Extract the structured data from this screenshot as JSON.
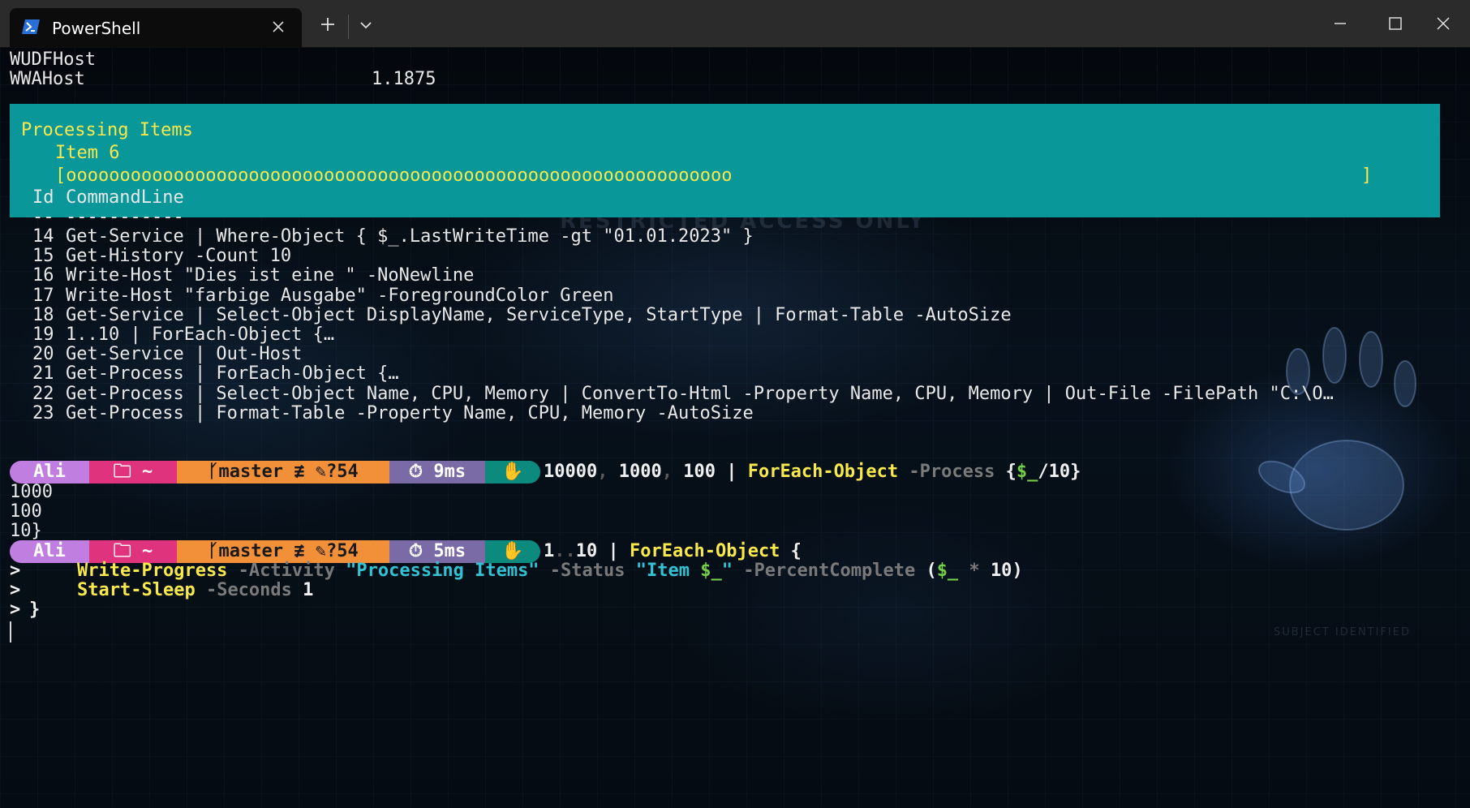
{
  "window": {
    "tab_title": "PowerShell",
    "tab_icon": "powershell-icon",
    "new_tab_icon": "plus-icon",
    "dropdown_icon": "chevron-down-icon",
    "minimize_icon": "minimize-icon",
    "maximize_icon": "maximize-icon",
    "close_icon": "close-icon"
  },
  "background": {
    "watermark": "RESTRICTED ACCESS ONLY",
    "watermark2": "SUBJECT IDENTIFIED"
  },
  "output_top": [
    {
      "name": "WUDFHost",
      "value": ""
    },
    {
      "name": "WWAHost",
      "value": "1.1875"
    }
  ],
  "progress": {
    "activity": "Processing Items",
    "status": "Item 6",
    "bar_open": "[",
    "bar_fill": "oooooooooooooooooooooooooooooooooooooooooooooooooooooooooooooo",
    "bar_close": "]",
    "percent_complete": 0.6,
    "background_color": "#0a979a",
    "text_color": "#f7e84c"
  },
  "history": {
    "header_id": "Id",
    "header_cmd": "CommandLine",
    "rule_id": "--",
    "rule_cmd": "-----------",
    "rows": [
      {
        "id": "14",
        "cmd": "Get-Service | Where-Object { $_.LastWriteTime -gt \"01.01.2023\" }"
      },
      {
        "id": "15",
        "cmd": "Get-History -Count 10"
      },
      {
        "id": "16",
        "cmd": "Write-Host \"Dies ist eine \" -NoNewline"
      },
      {
        "id": "17",
        "cmd": "Write-Host \"farbige Ausgabe\" -ForegroundColor Green"
      },
      {
        "id": "18",
        "cmd": "Get-Service | Select-Object DisplayName, ServiceType, StartType | Format-Table -AutoSize"
      },
      {
        "id": "19",
        "cmd": "1..10 | ForEach-Object {…"
      },
      {
        "id": "20",
        "cmd": "Get-Service | Out-Host"
      },
      {
        "id": "21",
        "cmd": "Get-Process | ForEach-Object {…"
      },
      {
        "id": "22",
        "cmd": "Get-Process | Select-Object Name, CPU, Memory | ConvertTo-Html -Property Name, CPU, Memory | Out-File -FilePath \"C:\\O…"
      },
      {
        "id": "23",
        "cmd": "Get-Process | Format-Table -Property Name, CPU, Memory -AutoSize"
      }
    ]
  },
  "prompt1": {
    "user": "Ali",
    "path": "~",
    "path_icon": "folder-icon",
    "branch_icon": "git-branch-icon",
    "branch": "master",
    "sync": "≢",
    "edit_icon": "edit-icon",
    "untracked": "?54",
    "time_icon": "stopwatch-icon",
    "time": "9ms",
    "os_icon": "shell-icon",
    "cmd_num1": "10000",
    "cmd_comma1": ",",
    "cmd_num2": " 1000",
    "cmd_comma2": ",",
    "cmd_num3": " 100",
    "cmd_pipe": " | ",
    "cmd_cmdlet": "ForEach-Object",
    "cmd_param": " -Process",
    "cmd_brace_open": " {",
    "cmd_var": "$_",
    "cmd_tail": "/10}"
  },
  "output_mid": [
    "1000",
    "100",
    "10}"
  ],
  "prompt2": {
    "user": "Ali",
    "path": "~",
    "branch": "master",
    "sync": "≢",
    "untracked": "?54",
    "time": "5ms",
    "cmd_start": "1",
    "cmd_range": "..",
    "cmd_end": "10",
    "cmd_pipe": " | ",
    "cmd_cmdlet": "ForEach-Object",
    "cmd_brace": " {"
  },
  "continuation": {
    "marker": ">",
    "line1": {
      "cmdlet": "Write-Progress",
      "p1": " -Activity ",
      "s1": "\"Processing Items\"",
      "p2": " -Status ",
      "s2a": "\"Item ",
      "s2var": "$_",
      "s2b": "\"",
      "p3": " -PercentComplete ",
      "o": "(",
      "var": "$_",
      "op": " * ",
      "num": "10",
      "c": ")"
    },
    "line2": {
      "cmdlet": "Start-Sleep",
      "p1": " -Seconds ",
      "num": "1"
    },
    "line3": "}"
  }
}
